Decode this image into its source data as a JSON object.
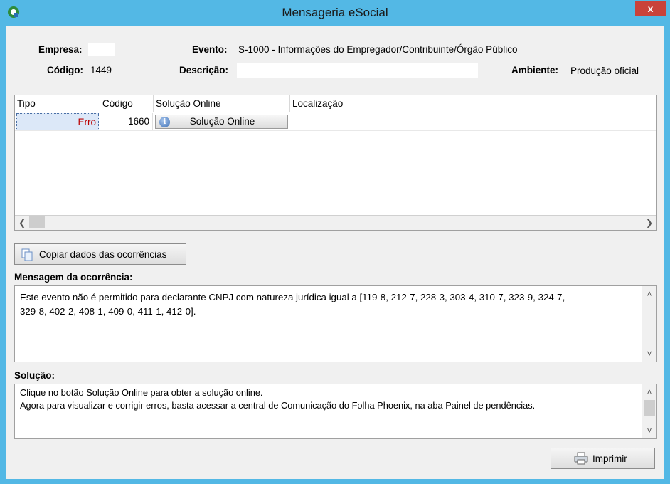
{
  "window": {
    "title": "Mensageria eSocial",
    "close_label": "x"
  },
  "header": {
    "empresa_label": "Empresa:",
    "empresa_value": "",
    "codigo_label": "Código:",
    "codigo_value": "1449",
    "evento_label": "Evento:",
    "evento_value": "S-1000 - Informações do Empregador/Contribuinte/Órgão Público",
    "descricao_label": "Descrição:",
    "descricao_value": "",
    "ambiente_label": "Ambiente:",
    "ambiente_value": "Produção oficial"
  },
  "grid": {
    "columns": [
      "Tipo",
      "Código",
      "Solução Online",
      "Localização"
    ],
    "rows": [
      {
        "tipo": "Erro",
        "codigo": "1660",
        "solucao_button": "Solução Online",
        "localizacao": ""
      }
    ]
  },
  "copy_button": {
    "label": "Copiar dados das ocorrências"
  },
  "mensagem": {
    "label": "Mensagem da ocorrência:",
    "text": "Este evento não é permitido para declarante CNPJ com natureza jurídica igual a [119-8, 212-7, 228-3, 303-4, 310-7, 323-9, 324-7,\n329-8, 402-2, 408-1, 409-0, 411-1, 412-0]."
  },
  "solucao": {
    "label": "Solução:",
    "text": "Clique no botão Solução Online para obter a solução online.\nAgora para visualizar e corrigir erros, basta acessar a central de Comunicação do Folha Phoenix, na aba Painel de pendências."
  },
  "print_button": {
    "label": "Imprimir"
  },
  "colors": {
    "titlebar": "#53b8e5",
    "close": "#c9423a",
    "erro_text": "#bb0000"
  }
}
